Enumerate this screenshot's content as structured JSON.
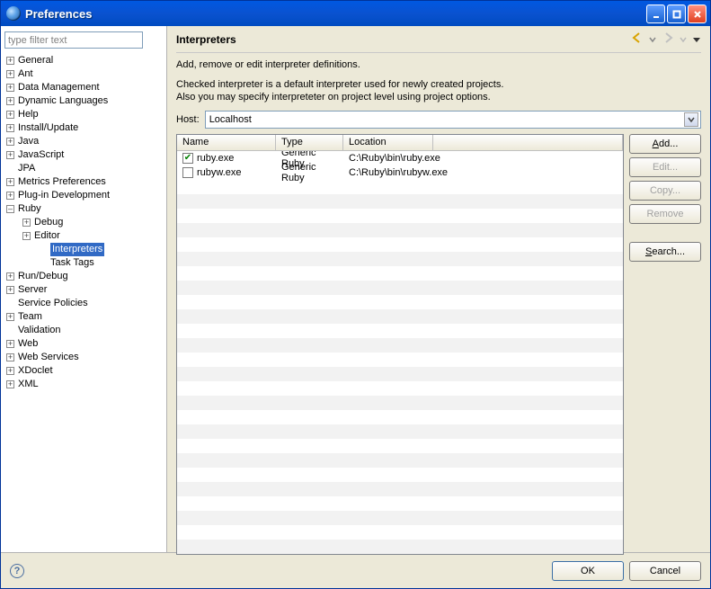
{
  "window": {
    "title": "Preferences"
  },
  "left": {
    "filter_placeholder": "type filter text",
    "items": [
      {
        "label": "General",
        "level": 0,
        "expand": "+"
      },
      {
        "label": "Ant",
        "level": 0,
        "expand": "+"
      },
      {
        "label": "Data Management",
        "level": 0,
        "expand": "+"
      },
      {
        "label": "Dynamic Languages",
        "level": 0,
        "expand": "+"
      },
      {
        "label": "Help",
        "level": 0,
        "expand": "+"
      },
      {
        "label": "Install/Update",
        "level": 0,
        "expand": "+"
      },
      {
        "label": "Java",
        "level": 0,
        "expand": "+"
      },
      {
        "label": "JavaScript",
        "level": 0,
        "expand": "+"
      },
      {
        "label": "JPA",
        "level": 0,
        "expand": ""
      },
      {
        "label": "Metrics Preferences",
        "level": 0,
        "expand": "+"
      },
      {
        "label": "Plug-in Development",
        "level": 0,
        "expand": "+"
      },
      {
        "label": "Ruby",
        "level": 0,
        "expand": "-"
      },
      {
        "label": "Debug",
        "level": 1,
        "expand": "+"
      },
      {
        "label": "Editor",
        "level": 1,
        "expand": "+"
      },
      {
        "label": "Interpreters",
        "level": 2,
        "expand": "",
        "selected": true
      },
      {
        "label": "Task Tags",
        "level": 2,
        "expand": ""
      },
      {
        "label": "Run/Debug",
        "level": 0,
        "expand": "+"
      },
      {
        "label": "Server",
        "level": 0,
        "expand": "+"
      },
      {
        "label": "Service Policies",
        "level": 0,
        "expand": ""
      },
      {
        "label": "Team",
        "level": 0,
        "expand": "+"
      },
      {
        "label": "Validation",
        "level": 0,
        "expand": ""
      },
      {
        "label": "Web",
        "level": 0,
        "expand": "+"
      },
      {
        "label": "Web Services",
        "level": 0,
        "expand": "+"
      },
      {
        "label": "XDoclet",
        "level": 0,
        "expand": "+"
      },
      {
        "label": "XML",
        "level": 0,
        "expand": "+"
      }
    ]
  },
  "right": {
    "title": "Interpreters",
    "desc_line1": "Add, remove or edit interpreter definitions.",
    "desc_line2": "Checked interpreter is a default interpreter used for newly created projects.",
    "desc_line3": "Also you may specify interpreteter on project level using project options.",
    "host_label": "Host:",
    "host_value": "Localhost",
    "columns": {
      "name": "Name",
      "type": "Type",
      "location": "Location"
    },
    "rows": [
      {
        "checked": true,
        "name": "ruby.exe",
        "type": "Generic Ruby",
        "location": "C:\\Ruby\\bin\\ruby.exe"
      },
      {
        "checked": false,
        "name": "rubyw.exe",
        "type": "Generic Ruby",
        "location": "C:\\Ruby\\bin\\rubyw.exe"
      }
    ],
    "buttons": {
      "add": "Add...",
      "edit": "Edit...",
      "copy": "Copy...",
      "remove": "Remove",
      "search": "Search..."
    }
  },
  "footer": {
    "ok": "OK",
    "cancel": "Cancel"
  }
}
